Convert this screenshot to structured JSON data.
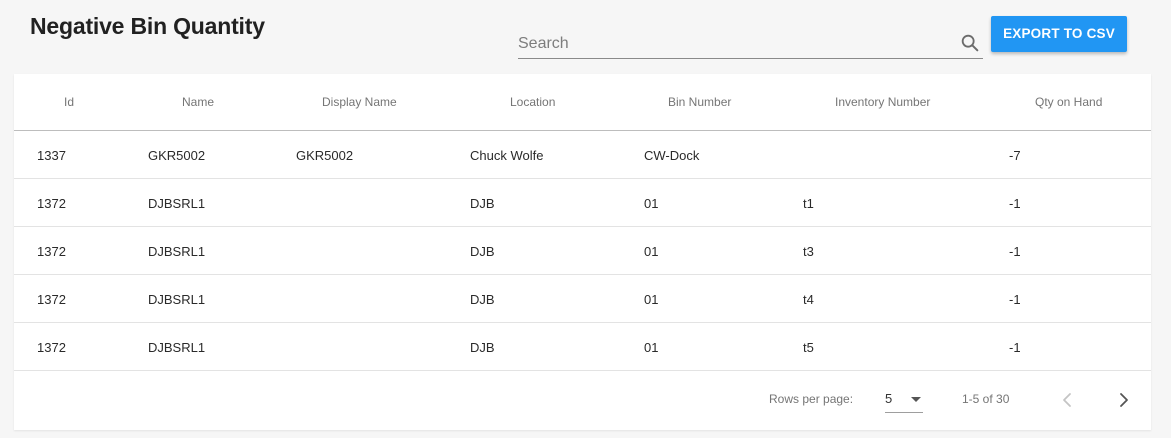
{
  "header": {
    "title": "Negative Bin Quantity"
  },
  "search": {
    "placeholder": "Search",
    "value": ""
  },
  "toolbar": {
    "export_label": "EXPORT TO CSV"
  },
  "colors": {
    "accent": "#2196f3",
    "background": "#f6f6f6"
  },
  "table": {
    "columns": [
      "Id",
      "Name",
      "Display Name",
      "Location",
      "Bin Number",
      "Inventory Number",
      "Qty on Hand"
    ],
    "rows": [
      [
        "1337",
        "GKR5002",
        "GKR5002",
        "Chuck Wolfe",
        "CW-Dock",
        "",
        "-7"
      ],
      [
        "1372",
        "DJBSRL1",
        "",
        "DJB",
        "01",
        "t1",
        "-1"
      ],
      [
        "1372",
        "DJBSRL1",
        "",
        "DJB",
        "01",
        "t3",
        "-1"
      ],
      [
        "1372",
        "DJBSRL1",
        "",
        "DJB",
        "01",
        "t4",
        "-1"
      ],
      [
        "1372",
        "DJBSRL1",
        "",
        "DJB",
        "01",
        "t5",
        "-1"
      ]
    ]
  },
  "pagination": {
    "rows_per_page_label": "Rows per page:",
    "rows_per_page_value": "5",
    "range_label": "1-5 of 30",
    "prev_icon": "chevron-left-icon",
    "next_icon": "chevron-right-icon"
  }
}
